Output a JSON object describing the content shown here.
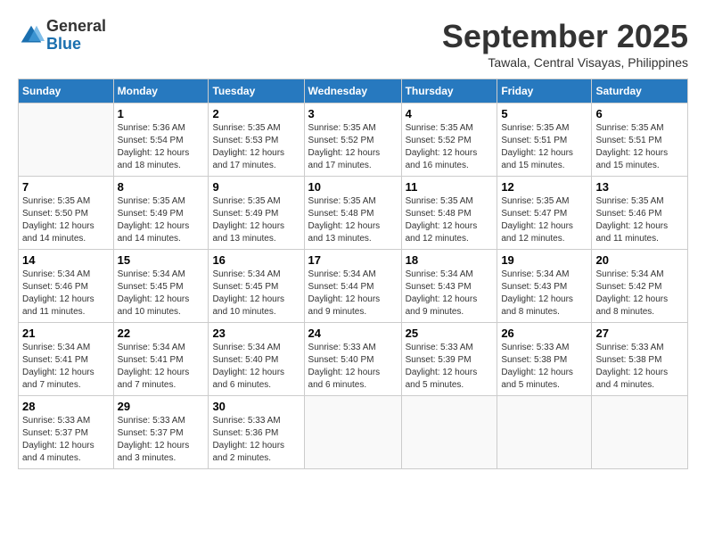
{
  "logo": {
    "general": "General",
    "blue": "Blue"
  },
  "title": "September 2025",
  "location": "Tawala, Central Visayas, Philippines",
  "days_of_week": [
    "Sunday",
    "Monday",
    "Tuesday",
    "Wednesday",
    "Thursday",
    "Friday",
    "Saturday"
  ],
  "weeks": [
    [
      {
        "day": "",
        "info": ""
      },
      {
        "day": "1",
        "info": "Sunrise: 5:36 AM\nSunset: 5:54 PM\nDaylight: 12 hours\nand 18 minutes."
      },
      {
        "day": "2",
        "info": "Sunrise: 5:35 AM\nSunset: 5:53 PM\nDaylight: 12 hours\nand 17 minutes."
      },
      {
        "day": "3",
        "info": "Sunrise: 5:35 AM\nSunset: 5:52 PM\nDaylight: 12 hours\nand 17 minutes."
      },
      {
        "day": "4",
        "info": "Sunrise: 5:35 AM\nSunset: 5:52 PM\nDaylight: 12 hours\nand 16 minutes."
      },
      {
        "day": "5",
        "info": "Sunrise: 5:35 AM\nSunset: 5:51 PM\nDaylight: 12 hours\nand 15 minutes."
      },
      {
        "day": "6",
        "info": "Sunrise: 5:35 AM\nSunset: 5:51 PM\nDaylight: 12 hours\nand 15 minutes."
      }
    ],
    [
      {
        "day": "7",
        "info": "Sunrise: 5:35 AM\nSunset: 5:50 PM\nDaylight: 12 hours\nand 14 minutes."
      },
      {
        "day": "8",
        "info": "Sunrise: 5:35 AM\nSunset: 5:49 PM\nDaylight: 12 hours\nand 14 minutes."
      },
      {
        "day": "9",
        "info": "Sunrise: 5:35 AM\nSunset: 5:49 PM\nDaylight: 12 hours\nand 13 minutes."
      },
      {
        "day": "10",
        "info": "Sunrise: 5:35 AM\nSunset: 5:48 PM\nDaylight: 12 hours\nand 13 minutes."
      },
      {
        "day": "11",
        "info": "Sunrise: 5:35 AM\nSunset: 5:48 PM\nDaylight: 12 hours\nand 12 minutes."
      },
      {
        "day": "12",
        "info": "Sunrise: 5:35 AM\nSunset: 5:47 PM\nDaylight: 12 hours\nand 12 minutes."
      },
      {
        "day": "13",
        "info": "Sunrise: 5:35 AM\nSunset: 5:46 PM\nDaylight: 12 hours\nand 11 minutes."
      }
    ],
    [
      {
        "day": "14",
        "info": "Sunrise: 5:34 AM\nSunset: 5:46 PM\nDaylight: 12 hours\nand 11 minutes."
      },
      {
        "day": "15",
        "info": "Sunrise: 5:34 AM\nSunset: 5:45 PM\nDaylight: 12 hours\nand 10 minutes."
      },
      {
        "day": "16",
        "info": "Sunrise: 5:34 AM\nSunset: 5:45 PM\nDaylight: 12 hours\nand 10 minutes."
      },
      {
        "day": "17",
        "info": "Sunrise: 5:34 AM\nSunset: 5:44 PM\nDaylight: 12 hours\nand 9 minutes."
      },
      {
        "day": "18",
        "info": "Sunrise: 5:34 AM\nSunset: 5:43 PM\nDaylight: 12 hours\nand 9 minutes."
      },
      {
        "day": "19",
        "info": "Sunrise: 5:34 AM\nSunset: 5:43 PM\nDaylight: 12 hours\nand 8 minutes."
      },
      {
        "day": "20",
        "info": "Sunrise: 5:34 AM\nSunset: 5:42 PM\nDaylight: 12 hours\nand 8 minutes."
      }
    ],
    [
      {
        "day": "21",
        "info": "Sunrise: 5:34 AM\nSunset: 5:41 PM\nDaylight: 12 hours\nand 7 minutes."
      },
      {
        "day": "22",
        "info": "Sunrise: 5:34 AM\nSunset: 5:41 PM\nDaylight: 12 hours\nand 7 minutes."
      },
      {
        "day": "23",
        "info": "Sunrise: 5:34 AM\nSunset: 5:40 PM\nDaylight: 12 hours\nand 6 minutes."
      },
      {
        "day": "24",
        "info": "Sunrise: 5:33 AM\nSunset: 5:40 PM\nDaylight: 12 hours\nand 6 minutes."
      },
      {
        "day": "25",
        "info": "Sunrise: 5:33 AM\nSunset: 5:39 PM\nDaylight: 12 hours\nand 5 minutes."
      },
      {
        "day": "26",
        "info": "Sunrise: 5:33 AM\nSunset: 5:38 PM\nDaylight: 12 hours\nand 5 minutes."
      },
      {
        "day": "27",
        "info": "Sunrise: 5:33 AM\nSunset: 5:38 PM\nDaylight: 12 hours\nand 4 minutes."
      }
    ],
    [
      {
        "day": "28",
        "info": "Sunrise: 5:33 AM\nSunset: 5:37 PM\nDaylight: 12 hours\nand 4 minutes."
      },
      {
        "day": "29",
        "info": "Sunrise: 5:33 AM\nSunset: 5:37 PM\nDaylight: 12 hours\nand 3 minutes."
      },
      {
        "day": "30",
        "info": "Sunrise: 5:33 AM\nSunset: 5:36 PM\nDaylight: 12 hours\nand 2 minutes."
      },
      {
        "day": "",
        "info": ""
      },
      {
        "day": "",
        "info": ""
      },
      {
        "day": "",
        "info": ""
      },
      {
        "day": "",
        "info": ""
      }
    ]
  ]
}
